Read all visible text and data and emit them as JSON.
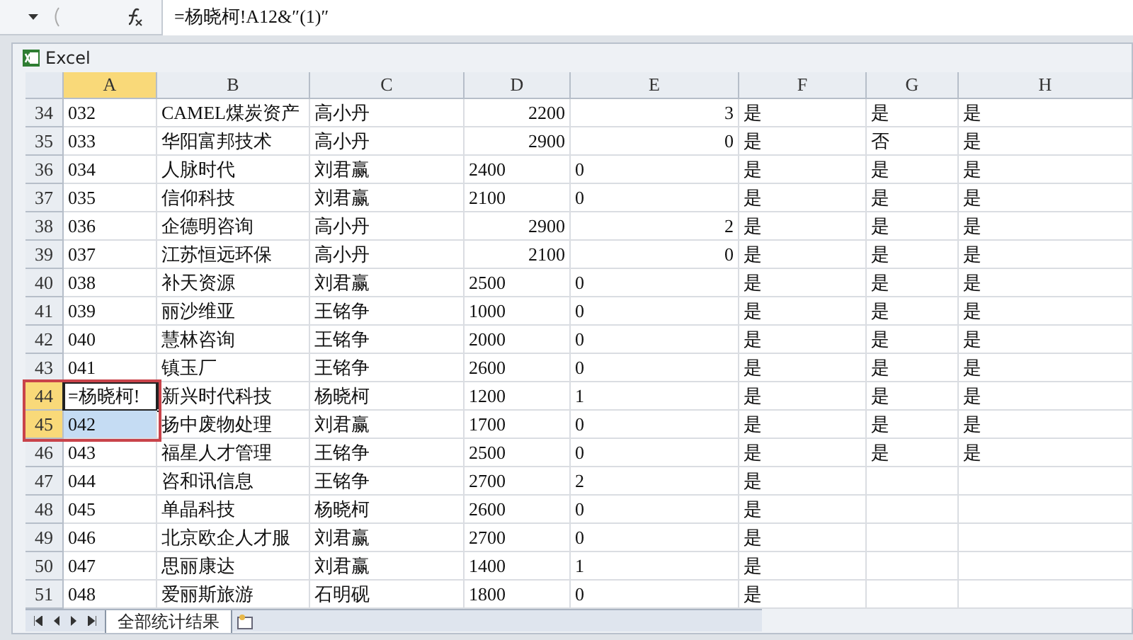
{
  "formula_bar": {
    "formula": "=杨晓柯!A12&″(1)″"
  },
  "window": {
    "title": "Excel"
  },
  "columns": [
    {
      "label": "A",
      "selected": true
    },
    {
      "label": "B",
      "selected": false
    },
    {
      "label": "C",
      "selected": false
    },
    {
      "label": "D",
      "selected": false
    },
    {
      "label": "E",
      "selected": false
    },
    {
      "label": "F",
      "selected": false
    },
    {
      "label": "G",
      "selected": false
    },
    {
      "label": "H",
      "selected": false
    }
  ],
  "rows": [
    {
      "number": "34",
      "numeric": true,
      "selected": false,
      "active": false,
      "cells": [
        "032",
        "CAMEL煤炭资产",
        "高小丹",
        "2200",
        "3",
        "是",
        "是",
        "是"
      ]
    },
    {
      "number": "35",
      "numeric": true,
      "selected": false,
      "active": false,
      "cells": [
        "033",
        "华阳富邦技术",
        "高小丹",
        "2900",
        "0",
        "是",
        "否",
        "是"
      ]
    },
    {
      "number": "36",
      "numeric": false,
      "selected": false,
      "active": false,
      "cells": [
        "034",
        "人脉时代",
        "刘君赢",
        "2400",
        "0",
        "是",
        "是",
        "是"
      ]
    },
    {
      "number": "37",
      "numeric": false,
      "selected": false,
      "active": false,
      "cells": [
        "035",
        "信仰科技",
        "刘君赢",
        "2100",
        "0",
        "是",
        "是",
        "是"
      ]
    },
    {
      "number": "38",
      "numeric": true,
      "selected": false,
      "active": false,
      "cells": [
        "036",
        "企德明咨询",
        "高小丹",
        "2900",
        "2",
        "是",
        "是",
        "是"
      ]
    },
    {
      "number": "39",
      "numeric": true,
      "selected": false,
      "active": false,
      "cells": [
        "037",
        "江苏恒远环保",
        "高小丹",
        "2100",
        "0",
        "是",
        "是",
        "是"
      ]
    },
    {
      "number": "40",
      "numeric": false,
      "selected": false,
      "active": false,
      "cells": [
        "038",
        "补天资源",
        "刘君赢",
        "2500",
        "0",
        "是",
        "是",
        "是"
      ]
    },
    {
      "number": "41",
      "numeric": false,
      "selected": false,
      "active": false,
      "cells": [
        "039",
        "丽沙维亚",
        "王铭争",
        "1000",
        "0",
        "是",
        "是",
        "是"
      ]
    },
    {
      "number": "42",
      "numeric": false,
      "selected": false,
      "active": false,
      "cells": [
        "040",
        "慧林咨询",
        "王铭争",
        "2000",
        "0",
        "是",
        "是",
        "是"
      ]
    },
    {
      "number": "43",
      "numeric": false,
      "selected": false,
      "active": false,
      "cells": [
        "041",
        "镇玉厂",
        "王铭争",
        "2600",
        "0",
        "是",
        "是",
        "是"
      ]
    },
    {
      "number": "44",
      "numeric": false,
      "selected": true,
      "active": true,
      "cells": [
        "=杨晓柯!",
        "新兴时代科技",
        "杨晓柯",
        "1200",
        "1",
        "是",
        "是",
        "是"
      ]
    },
    {
      "number": "45",
      "numeric": false,
      "selected": true,
      "active": false,
      "cells": [
        "042",
        "扬中废物处理",
        "刘君赢",
        "1700",
        "0",
        "是",
        "是",
        "是"
      ]
    },
    {
      "number": "46",
      "numeric": false,
      "selected": false,
      "active": false,
      "cells": [
        "043",
        "福星人才管理",
        "王铭争",
        "2500",
        "0",
        "是",
        "是",
        "是"
      ]
    },
    {
      "number": "47",
      "numeric": false,
      "selected": false,
      "active": false,
      "cells": [
        "044",
        "咨和讯信息",
        "王铭争",
        "2700",
        "2",
        "是"
      ]
    },
    {
      "number": "48",
      "numeric": false,
      "selected": false,
      "active": false,
      "cells": [
        "045",
        "单晶科技",
        "杨晓柯",
        "2600",
        "0",
        "是"
      ]
    },
    {
      "number": "49",
      "numeric": false,
      "selected": false,
      "active": false,
      "cells": [
        "046",
        "北京欧企人才服",
        "刘君赢",
        "2700",
        "0",
        "是"
      ]
    },
    {
      "number": "50",
      "numeric": false,
      "selected": false,
      "active": false,
      "cells": [
        "047",
        "思丽康达",
        "刘君赢",
        "1400",
        "1",
        "是"
      ]
    },
    {
      "number": "51",
      "numeric": false,
      "selected": false,
      "active": false,
      "cells": [
        "048",
        "爱丽斯旅游",
        "石明砚",
        "1800",
        "0",
        "是"
      ]
    }
  ],
  "sheet_tabs": [
    {
      "label": "全部统计结果",
      "selected": true
    }
  ]
}
